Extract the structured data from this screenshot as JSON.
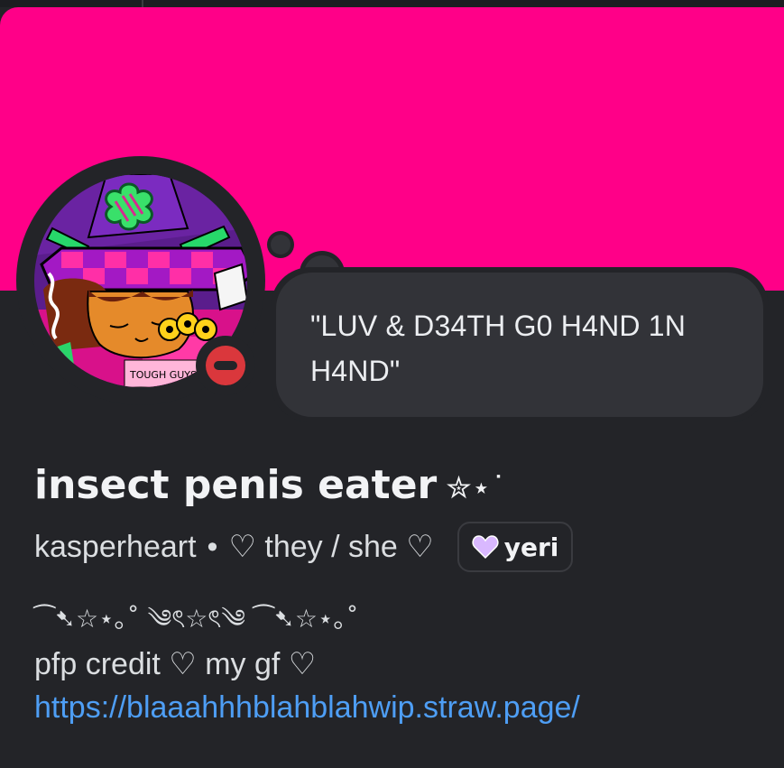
{
  "colors": {
    "banner": "#ff0088",
    "background": "#232428",
    "bubble": "#323338",
    "status_dnd": "#da373c",
    "link": "#4e9ef5",
    "tag_heart": "#d9b8ff"
  },
  "profile": {
    "display_name": "insect penis eater",
    "display_name_decoration": "✮⋆˙",
    "username": "kasperheart",
    "separator": "•",
    "pronouns": "♡ they / she ♡",
    "status": "do-not-disturb",
    "avatar_icon": "avatar-icon",
    "avatar_caption": "TOUGH GUYS",
    "custom_status": "\"LUV & D34TH G0 H4ND 1N H4ND\"",
    "tag": {
      "icon": "heart-icon",
      "name": "yeri"
    },
    "bio": {
      "decoration": "⁀➷☆⋆｡˚ ༄ৎ☆ৎ༄ ⁀➷☆⋆｡˚",
      "line": "pfp credit ♡ my gf ♡",
      "link": "https://blaaahhhblahblahwip.straw.page/"
    }
  }
}
